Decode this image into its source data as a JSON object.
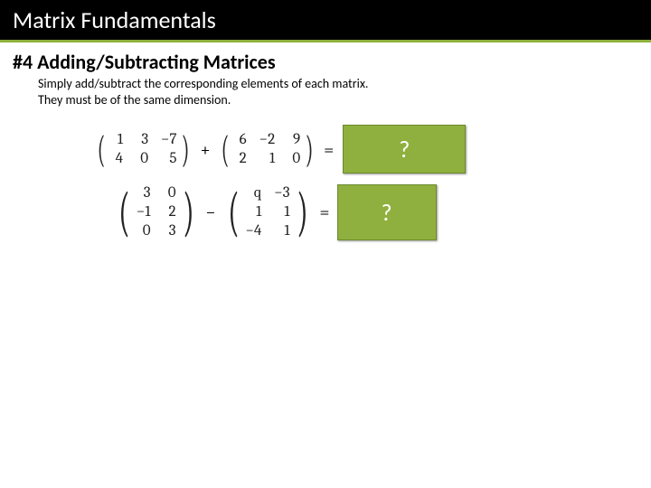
{
  "header": {
    "title": "Matrix Fundamentals"
  },
  "section": {
    "heading": "#4 Adding/Subtracting Matrices",
    "desc_line1": "Simply add/subtract the corresponding elements of each matrix.",
    "desc_line2": "They must be of the same dimension."
  },
  "eq1": {
    "A": [
      [
        "1",
        "3",
        "−7"
      ],
      [
        "4",
        "0",
        "5"
      ]
    ],
    "op": "+",
    "B": [
      [
        "6",
        "−2",
        "9"
      ],
      [
        "2",
        "1",
        "0"
      ]
    ],
    "equals": "=",
    "answer_placeholder": "?"
  },
  "eq2": {
    "A": [
      [
        "3",
        "0"
      ],
      [
        "−1",
        "2"
      ],
      [
        "0",
        "3"
      ]
    ],
    "op": "−",
    "B": [
      [
        "q",
        "−3"
      ],
      [
        "1",
        "1"
      ],
      [
        "−4",
        "1"
      ]
    ],
    "equals": "=",
    "answer_placeholder": "?"
  }
}
